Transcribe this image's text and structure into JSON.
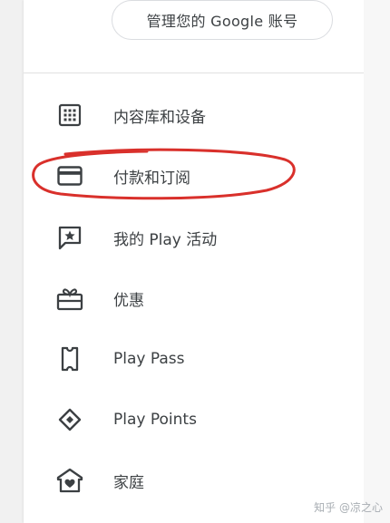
{
  "account": {
    "manage_button_label": "管理您的 Google 账号"
  },
  "menu": {
    "items": [
      {
        "label": "内容库和设备",
        "icon": "grid-icon"
      },
      {
        "label": "付款和订阅",
        "icon": "credit-card-icon"
      },
      {
        "label": "我的 Play 活动",
        "icon": "star-comment-icon"
      },
      {
        "label": "优惠",
        "icon": "gift-icon"
      },
      {
        "label": "Play Pass",
        "icon": "ticket-icon"
      },
      {
        "label": "Play Points",
        "icon": "diamond-icon"
      },
      {
        "label": "家庭",
        "icon": "family-home-icon"
      }
    ]
  },
  "annotation": {
    "highlighted_item": "付款和订阅",
    "color": "#d9302b"
  },
  "watermark": {
    "text": "知乎 @凉之心"
  },
  "colors": {
    "icon": "#3c4043",
    "text": "#3c4043",
    "divider": "#e0e0e0",
    "annotation": "#d9302b"
  }
}
